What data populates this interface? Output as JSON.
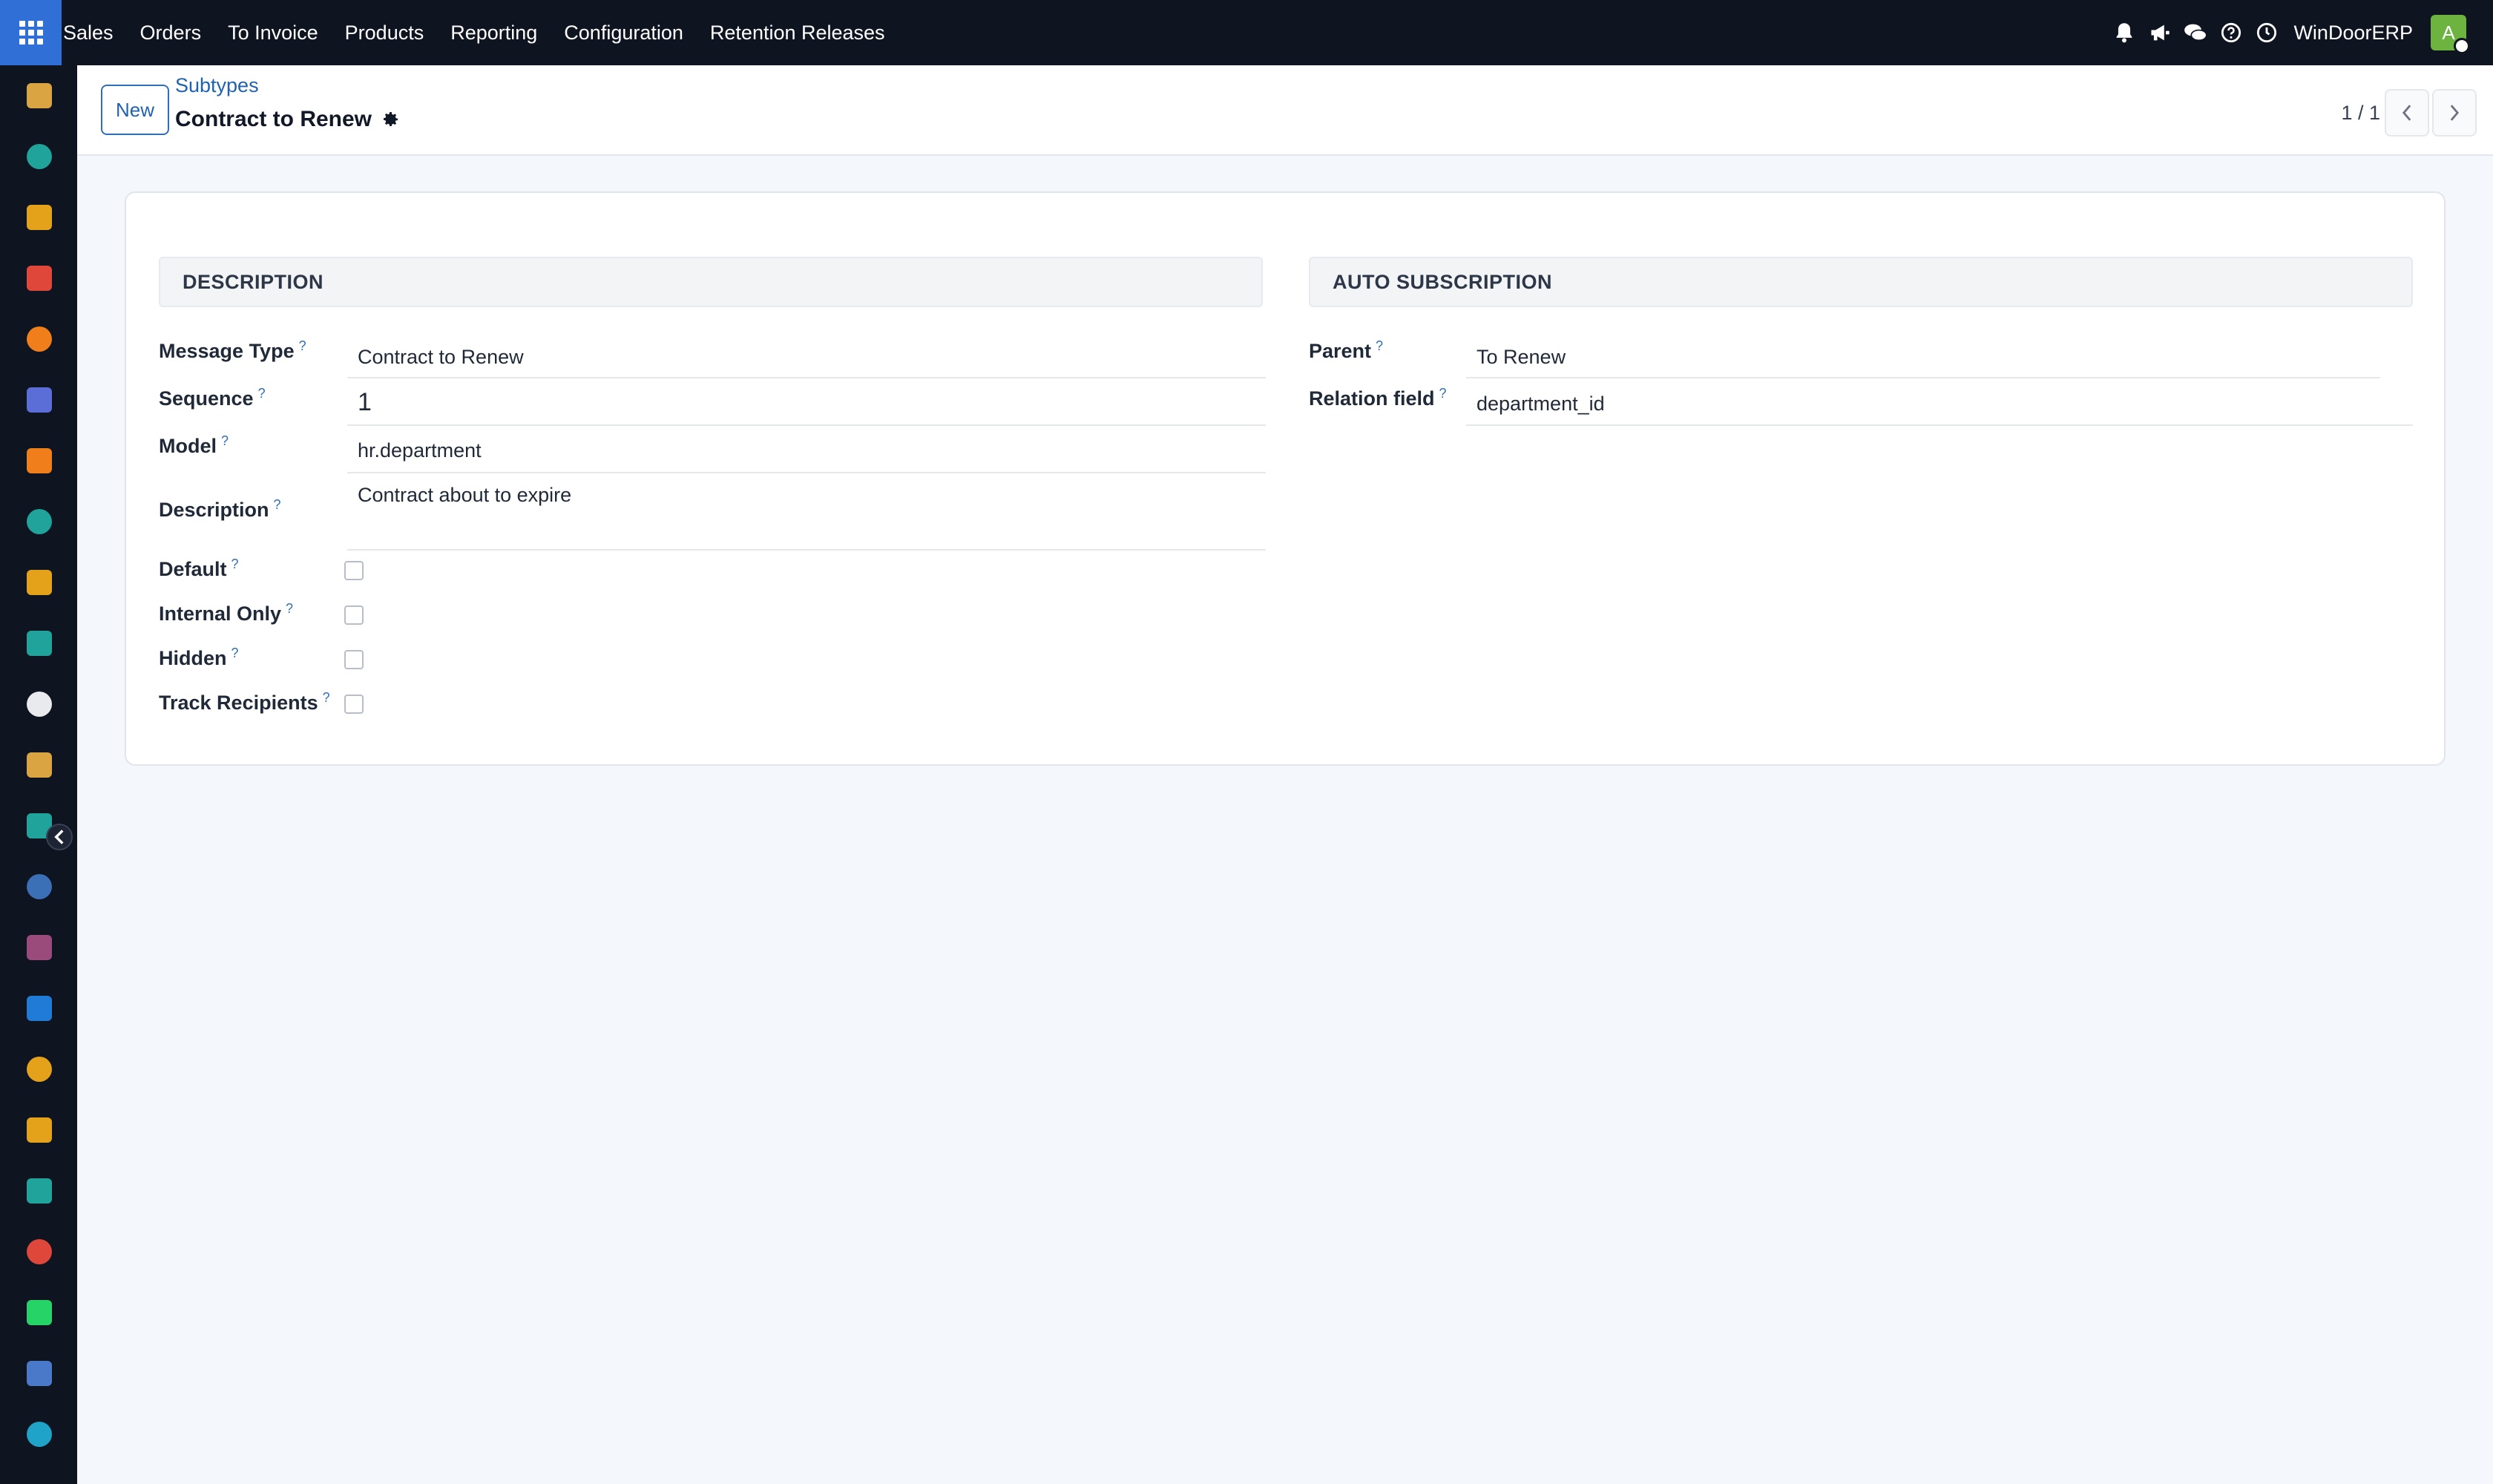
{
  "topbar": {
    "menu": [
      "Sales",
      "Orders",
      "To Invoice",
      "Products",
      "Reporting",
      "Configuration",
      "Retention Releases"
    ],
    "company": "WinDoorERP",
    "avatar_letter": "A",
    "icons": [
      "bell-icon",
      "megaphone-icon",
      "chat-icon",
      "help-icon",
      "clock-icon"
    ]
  },
  "sidebar": {
    "apps": [
      {
        "name": "discuss-app-icon",
        "color": "#d9a441"
      },
      {
        "name": "contacts-app-icon",
        "color": "#1fa39a"
      },
      {
        "name": "reporting-app-icon",
        "color": "#e3a21a"
      },
      {
        "name": "pie-app-icon",
        "color": "#e0473b"
      },
      {
        "name": "chat-bubble-app-icon",
        "color": "#f07f1b"
      },
      {
        "name": "mail-app-icon",
        "color": "#5b6ed8"
      },
      {
        "name": "livechat-app-icon",
        "color": "#f07f1b"
      },
      {
        "name": "inventory-app-icon",
        "color": "#1fa39a"
      },
      {
        "name": "reporting2-app-icon",
        "color": "#e3a21a"
      },
      {
        "name": "employees-app-icon",
        "color": "#1fa39a"
      },
      {
        "name": "cube-app-icon",
        "color": "#e8eaee"
      },
      {
        "name": "settings-app-icon",
        "color": "#d9a441"
      },
      {
        "name": "project-app-icon",
        "color": "#1fa39a"
      },
      {
        "name": "knowledge-app-icon",
        "color": "#3b6fb6"
      },
      {
        "name": "package-app-icon",
        "color": "#9b4b7b"
      },
      {
        "name": "invoicing-app-icon",
        "color": "#1f7bd6"
      },
      {
        "name": "team-app-icon",
        "color": "#e3a21a"
      },
      {
        "name": "calendar-app-icon",
        "color": "#e3a21a"
      },
      {
        "name": "sign-app-icon",
        "color": "#1fa39a"
      },
      {
        "name": "dashboard-app-icon",
        "color": "#e0473b"
      },
      {
        "name": "whatsapp-app-icon",
        "color": "#25d366"
      },
      {
        "name": "timer-app-icon",
        "color": "#4b79c9"
      },
      {
        "name": "wave-app-icon",
        "color": "#1fa3c8"
      }
    ]
  },
  "control": {
    "new_label": "New",
    "breadcrumb": "Subtypes",
    "title": "Contract to Renew",
    "pager": "1 / 1"
  },
  "form": {
    "left_header": "DESCRIPTION",
    "right_header": "AUTO SUBSCRIPTION",
    "help_mark": "?",
    "fields": {
      "message_type": {
        "label": "Message Type",
        "value": "Contract to Renew"
      },
      "sequence": {
        "label": "Sequence",
        "value": "1"
      },
      "model": {
        "label": "Model",
        "value": "hr.department"
      },
      "description": {
        "label": "Description",
        "value": "Contract about to expire"
      },
      "default": {
        "label": "Default",
        "checked": false
      },
      "internal_only": {
        "label": "Internal Only",
        "checked": false
      },
      "hidden": {
        "label": "Hidden",
        "checked": false
      },
      "track_recipients": {
        "label": "Track Recipients",
        "checked": false
      },
      "parent": {
        "label": "Parent",
        "value": "To Renew"
      },
      "relation_field": {
        "label": "Relation field",
        "value": "department_id"
      }
    }
  }
}
